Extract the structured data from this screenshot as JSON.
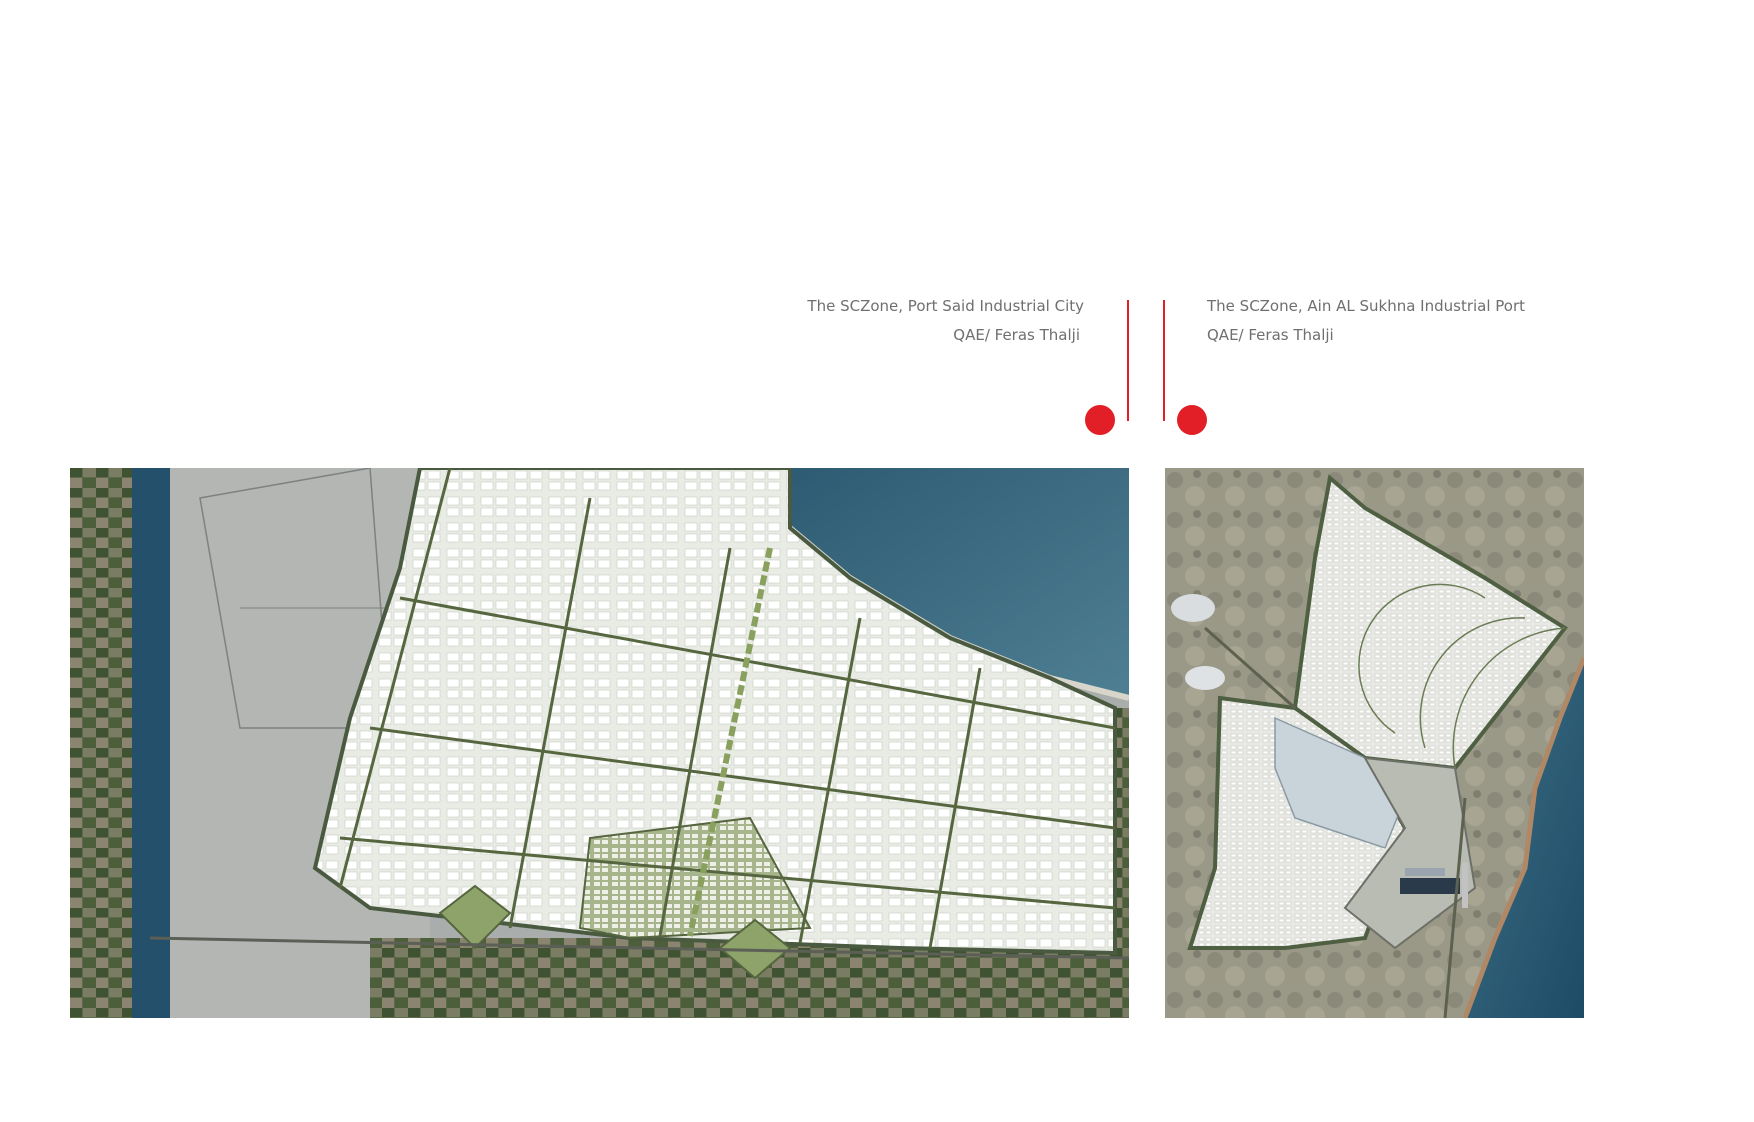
{
  "accent_color": "#e21e26",
  "projects": [
    {
      "title": "The SCZone, Port Said Industrial City",
      "credit": "QAE/ Feras Thalji"
    },
    {
      "title": "The SCZone, Ain AL Sukhna Industrial Port",
      "credit": "QAE/ Feras Thalji"
    }
  ]
}
